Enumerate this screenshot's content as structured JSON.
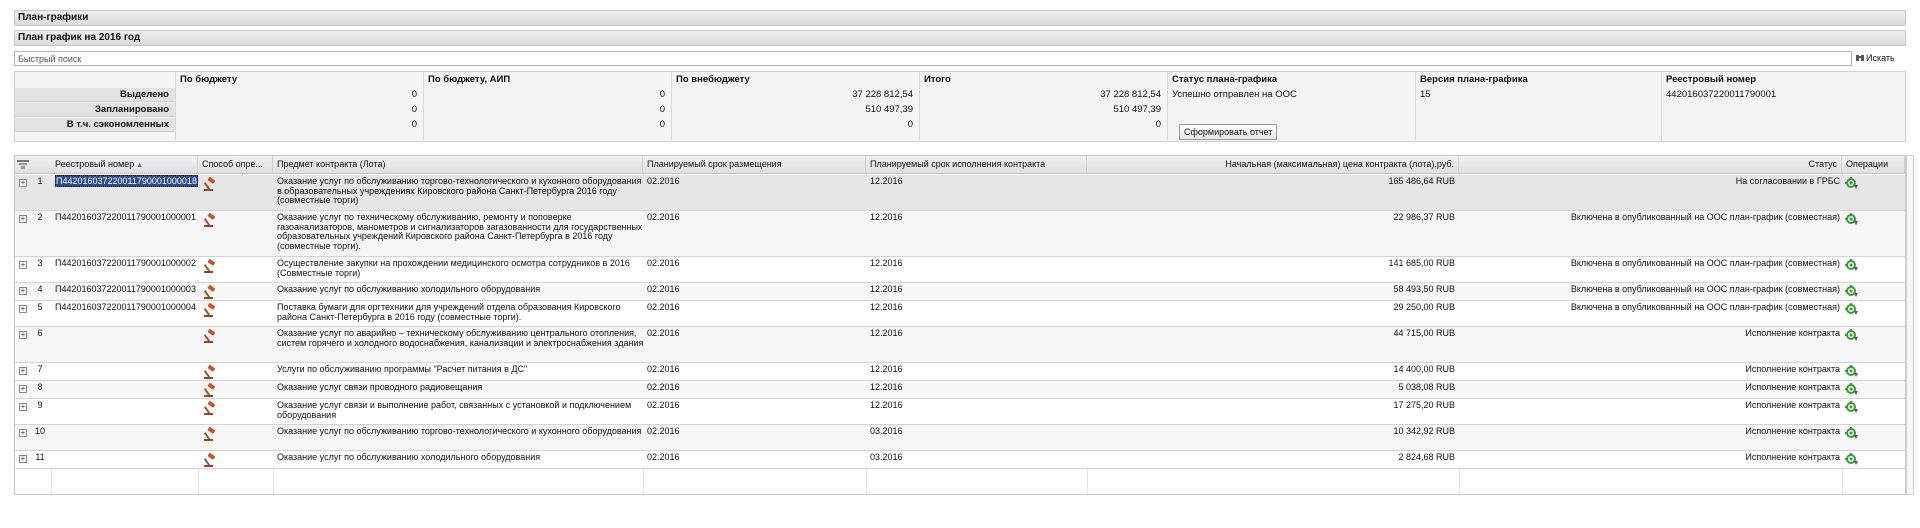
{
  "panel_title": "План-графики",
  "sub_title": "План график на 2016 год",
  "search": {
    "placeholder": "Быстрый поиск",
    "button_label": "Искать"
  },
  "summary": {
    "headers": [
      "По бюджету",
      "По бюджету, АИП",
      "По внебюджету",
      "Итого",
      "Статус плана-графика",
      "Версия плана-графика",
      "Реестровый номер"
    ],
    "rows": [
      {
        "label": "Выделено",
        "budget": "0",
        "aip": "0",
        "extra": "37 228 812,54",
        "total": "37 228 812,54"
      },
      {
        "label": "Запланировано",
        "budget": "0",
        "aip": "0",
        "extra": "510 497,39",
        "total": "510 497,39"
      },
      {
        "label": "В т.ч. сэкономленных",
        "budget": "0",
        "aip": "0",
        "extra": "0",
        "total": "0"
      }
    ],
    "plan_status": "Успешно отправлен на ООС",
    "plan_version": "15",
    "registry_number": "442016037220011790001",
    "report_button": "Сформировать отчет"
  },
  "grid": {
    "columns": {
      "registry": "Реестровый номер",
      "method": "Способ опре...",
      "subject": "Предмет контракта (Лота)",
      "placement": "Планируемый срок размещения",
      "execution": "Планируемый срок исполнения контракта",
      "price": "Начальная (максимальная) цена контракта (лота),руб.",
      "status": "Статус",
      "operations": "Операции"
    },
    "rows": [
      {
        "n": "1",
        "reg": "П442016037220011790001000018",
        "subject": "Оказание услуг по обслуживанию торгово-технологического и кухонного оборудования в образовательных учреждениях Кировского района Санкт-Петербурга 2016 году (совместные торги)",
        "place": "02.2016",
        "exec": "12.2016",
        "price": "165 486,64 RUB",
        "status": "На согласовании в ГРБС"
      },
      {
        "n": "2",
        "reg": "П442016037220011790001000001",
        "subject": "Оказание услуг по техническому обслуживанию, ремонту и поповерке газоанализаторов, манометров и сигнализаторов загазованности для государственных образовательных учреждений Кировского района Санкт-Петербурга в 2016 году (совместные торги).",
        "place": "02.2016",
        "exec": "12.2016",
        "price": "22 986,37 RUB",
        "status": "Включена в опубликованный на ООС план-график (совместная)"
      },
      {
        "n": "3",
        "reg": "П442016037220011790001000002",
        "subject": "Осуществление закупки на прохождении медицинского осмотра сотрудников в 2016 (Совместные торги)",
        "place": "02.2016",
        "exec": "12.2016",
        "price": "141 685,00 RUB",
        "status": "Включена в опубликованный на ООС план-график (совместная)"
      },
      {
        "n": "4",
        "reg": "П442016037220011790001000003",
        "subject": "Оказание услуг по обслуживанию холодильного оборудования",
        "place": "02.2016",
        "exec": "12.2016",
        "price": "58 493,50 RUB",
        "status": "Включена в опубликованный на ООС план-график (совместная)"
      },
      {
        "n": "5",
        "reg": "П442016037220011790001000004",
        "subject": "Поставка бумаги для оргтехники для учреждений отдела образования Кировского района Санкт-Петербурга в 2016 году (совместные торги).",
        "place": "02.2016",
        "exec": "12.2016",
        "price": "29 250,00 RUB",
        "status": "Включена в опубликованный на ООС план-график (совместная)"
      },
      {
        "n": "6",
        "reg": "",
        "subject": "Оказание услуг по аварийно – техническому обслуживанию центрального отопления, систем горячего и холодного водоснабжения, канализации и электроснабжения здания",
        "place": "02.2016",
        "exec": "12.2016",
        "price": "44 715,00 RUB",
        "status": "Исполнение контракта"
      },
      {
        "n": "7",
        "reg": "",
        "subject": "Услуги по обслуживанию программы \"Расчет питания в ДС\"",
        "place": "02.2016",
        "exec": "12.2016",
        "price": "14 400,00 RUB",
        "status": "Исполнение контракта"
      },
      {
        "n": "8",
        "reg": "",
        "subject": "Оказание услуг связи проводного радиовещания",
        "place": "02.2016",
        "exec": "12.2016",
        "price": "5 038,08 RUB",
        "status": "Исполнение контракта"
      },
      {
        "n": "9",
        "reg": "",
        "subject": "Оказание услуг связи и выполнение работ, связанных с установкой и подключением оборудования",
        "place": "02.2016",
        "exec": "12.2016",
        "price": "17 275,20 RUB",
        "status": "Исполнение контракта"
      },
      {
        "n": "10",
        "reg": "",
        "subject": "Оказание услуг по обслуживанию торгово-технологического и кухонного оборудования",
        "place": "02.2016",
        "exec": "03.2016",
        "price": "10 342,92 RUB",
        "status": "Исполнение контракта"
      },
      {
        "n": "11",
        "reg": "",
        "subject": "Оказание услуг по обслуживанию холодильного оборудования",
        "place": "02.2016",
        "exec": "03.2016",
        "price": "2 824,68 RUB",
        "status": "Исполнение контракта"
      }
    ]
  },
  "icons": {
    "method": "gavel-icon",
    "operations": "gear-refresh-icon",
    "accent_orange": "#c8542a",
    "operations_green": "#3a9a3a"
  }
}
